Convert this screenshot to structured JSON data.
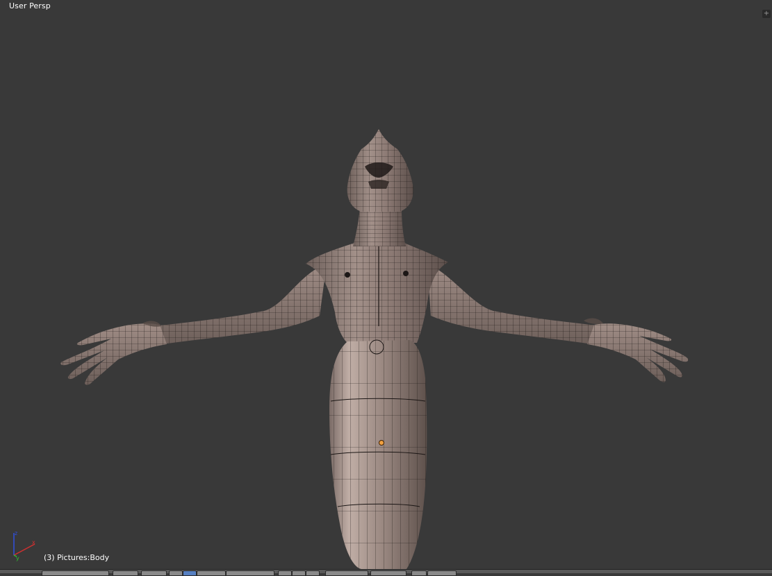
{
  "viewport": {
    "view_name": "User Persp",
    "object_info": "(3) Pictures:Body",
    "split_widget_icon": "plus-icon",
    "background_color": "#393939",
    "mesh_color": "#8a7872",
    "wire_color": "#1a1514",
    "origin_color": "#f0a040"
  },
  "axis_gizmo": {
    "x_label": "x",
    "y_label": "y",
    "z_label": "z",
    "x_color": "#d03030",
    "y_color": "#30c030",
    "z_color": "#3050e0"
  },
  "header": {
    "button_count": 14
  }
}
